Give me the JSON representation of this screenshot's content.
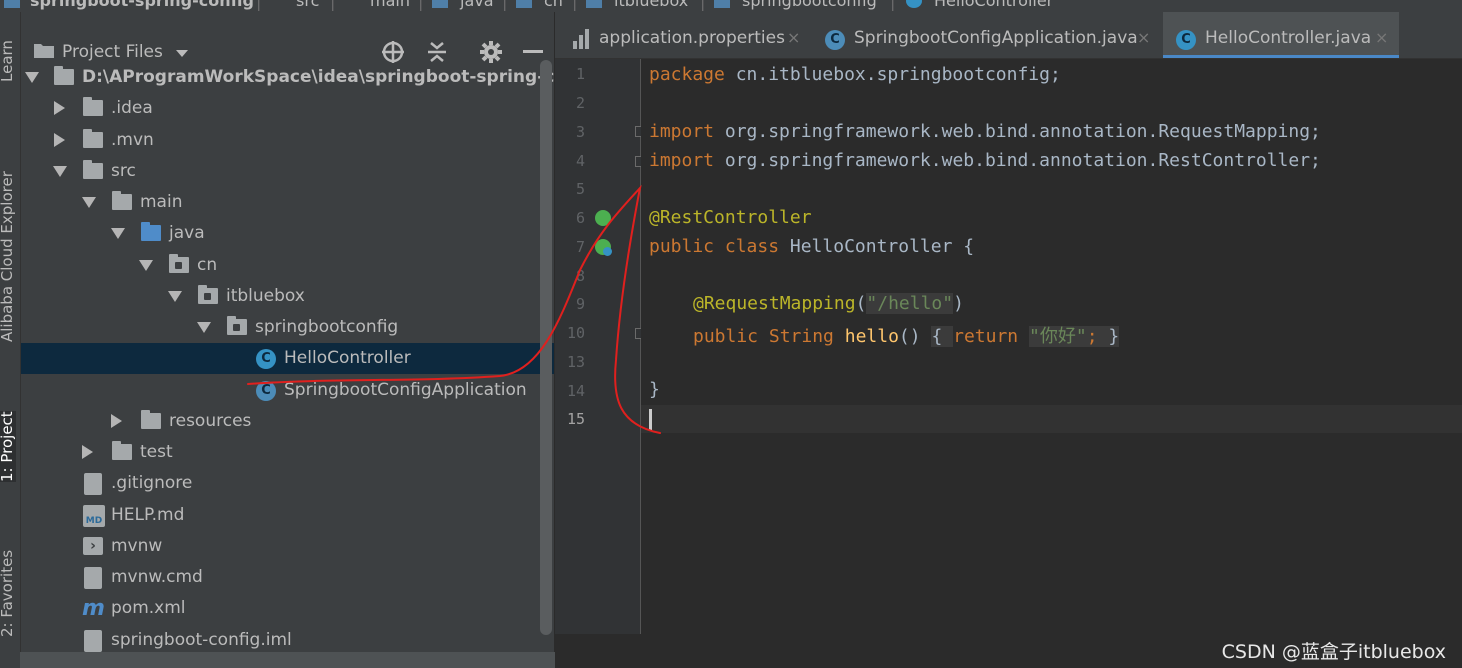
{
  "breadcrumbs": [
    "springboot-spring-config",
    "src",
    "main",
    "java",
    "cn",
    "itbluebox",
    "springbootconfig",
    "HelloController"
  ],
  "left_tool_tabs": [
    "Learn",
    "Alibaba Cloud Explorer",
    "1: Project",
    "2: Favorites"
  ],
  "project_panel": {
    "title": "Project Files",
    "tree": [
      {
        "label": "D:\\AProgramWorkSpace\\idea\\springboot-spring-config",
        "kind": "root",
        "state": "expanded"
      },
      {
        "label": ".idea",
        "kind": "folder",
        "state": "collapsed"
      },
      {
        "label": ".mvn",
        "kind": "folder",
        "state": "collapsed"
      },
      {
        "label": "src",
        "kind": "folder",
        "state": "expanded"
      },
      {
        "label": "main",
        "kind": "folder",
        "state": "expanded"
      },
      {
        "label": "java",
        "kind": "source-folder",
        "state": "expanded"
      },
      {
        "label": "cn",
        "kind": "package",
        "state": "expanded"
      },
      {
        "label": "itbluebox",
        "kind": "package",
        "state": "expanded"
      },
      {
        "label": "springbootconfig",
        "kind": "package",
        "state": "expanded"
      },
      {
        "label": "HelloController",
        "kind": "class",
        "state": "selected"
      },
      {
        "label": "SpringbootConfigApplication",
        "kind": "spring-class",
        "state": "none"
      },
      {
        "label": "resources",
        "kind": "resources-folder",
        "state": "collapsed"
      },
      {
        "label": "test",
        "kind": "folder",
        "state": "collapsed"
      },
      {
        "label": ".gitignore",
        "kind": "file",
        "state": "none"
      },
      {
        "label": "HELP.md",
        "kind": "md-file",
        "state": "none"
      },
      {
        "label": "mvnw",
        "kind": "cmd-file",
        "state": "none"
      },
      {
        "label": "mvnw.cmd",
        "kind": "file",
        "state": "none"
      },
      {
        "label": "pom.xml",
        "kind": "maven-file",
        "state": "none"
      },
      {
        "label": "springboot-config.iml",
        "kind": "file",
        "state": "none"
      }
    ]
  },
  "editor_tabs": [
    {
      "label": "application.properties",
      "icon": "properties-icon",
      "active": false
    },
    {
      "label": "SpringbootConfigApplication.java",
      "icon": "spring-class-icon",
      "active": false
    },
    {
      "label": "HelloController.java",
      "icon": "class-icon",
      "active": true
    }
  ],
  "close_glyph": "×",
  "class_glyph": "C",
  "editor": {
    "line_numbers": [
      "1",
      "2",
      "3",
      "4",
      "5",
      "6",
      "7",
      "8",
      "9",
      "10",
      "13",
      "14",
      "15"
    ],
    "code": {
      "l1_kw": "package",
      "l1_rest": " cn.itbluebox.springbootconfig;",
      "l3_kw": "import",
      "l3_rest": " org.springframework.web.bind.annotation.RequestMapping;",
      "l4_kw": "import",
      "l4_rest": " org.springframework.web.bind.annotation.RestController;",
      "l6_ann": "@RestController",
      "l7_kw": "public class",
      "l7_rest": " HelloController {",
      "l9_ann": "@RequestMapping",
      "l9_open": "(",
      "l9_str": "\"/hello\"",
      "l9_close": ")",
      "l10_kw": "public",
      "l10_type": " String ",
      "l10_fn": "hello",
      "l10_args": "() ",
      "l10_brace_open": "{ ",
      "l10_ret": "return",
      "l10_sp": " ",
      "l10_str": "\"你好\"",
      "l10_semi": "; ",
      "l10_brace_close": "}",
      "l14": "}"
    }
  },
  "watermark": "CSDN @蓝盒子itbluebox",
  "colors": {
    "annotation_stroke": "#e0201e",
    "selection": "#0d293e",
    "accent": "#4a88c7"
  }
}
